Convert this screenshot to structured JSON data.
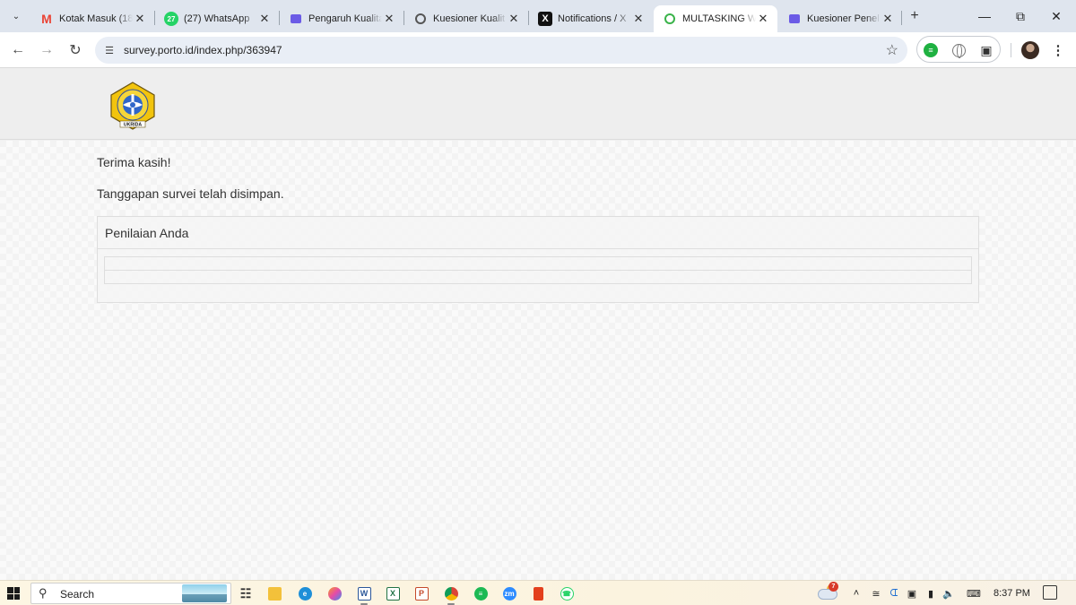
{
  "browser": {
    "tabs": [
      {
        "title": "Kotak Masuk (18",
        "icon": "gmail-icon"
      },
      {
        "title": "(27) WhatsApp",
        "icon": "whatsapp-icon",
        "badge": "27"
      },
      {
        "title": "Pengaruh Kualita",
        "icon": "forms-icon"
      },
      {
        "title": "Kuesioner Kualit",
        "icon": "openai-icon"
      },
      {
        "title": "Notifications / X",
        "icon": "x-icon"
      },
      {
        "title": "MULTASKING W",
        "icon": "survey-icon"
      },
      {
        "title": "Kuesioner Penel",
        "icon": "forms-icon"
      }
    ],
    "url": "survey.porto.id/index.php/363947"
  },
  "page": {
    "thanks": "Terima kasih!",
    "saved_message": "Tanggapan survei telah disimpan.",
    "panel_title": "Penilaian Anda",
    "logo_text": "UKRIDA"
  },
  "taskbar": {
    "search_label": "Search",
    "weather_badge": "7",
    "time": "8:37 PM",
    "apps": [
      "task-view-icon",
      "file-explorer-icon",
      "edge-icon",
      "copilot-icon",
      "word-icon",
      "excel-icon",
      "powerpoint-icon",
      "chrome-icon",
      "spotify-icon",
      "zoom-icon",
      "office-icon",
      "whatsapp-icon"
    ]
  }
}
